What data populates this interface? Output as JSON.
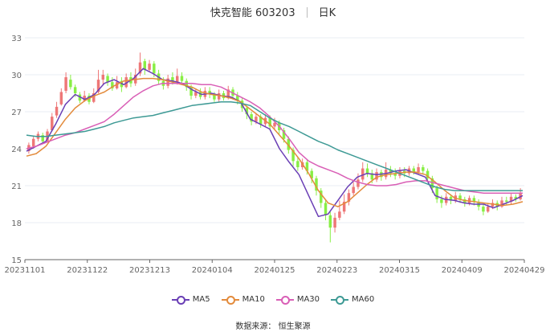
{
  "title": {
    "name": "快克智能 603203",
    "period": "日K"
  },
  "source": "数据来源： 恒生聚源",
  "colors": {
    "up": "#ee7777",
    "down": "#88ee44",
    "grid": "#e9ecf3",
    "axis": "#666666"
  },
  "chart_data": {
    "type": "candlestick",
    "ylim": [
      15,
      33
    ],
    "yticks": [
      15,
      18,
      21,
      24,
      27,
      30,
      33
    ],
    "xticks": [
      "20231101",
      "20231122",
      "20231213",
      "20240104",
      "20240125",
      "20240223",
      "20240315",
      "20240409",
      "20240429"
    ],
    "candles_approx": [
      [
        23.8,
        24.3,
        23.6,
        24.5
      ],
      [
        24.2,
        24.8,
        24.0,
        25.0
      ],
      [
        24.8,
        25.2,
        24.6,
        25.4
      ],
      [
        25.1,
        24.6,
        24.4,
        25.3
      ],
      [
        24.6,
        25.4,
        24.5,
        25.6
      ],
      [
        25.5,
        26.6,
        25.4,
        26.9
      ],
      [
        26.7,
        27.4,
        26.5,
        27.8
      ],
      [
        27.6,
        28.6,
        27.5,
        28.9
      ],
      [
        28.7,
        29.8,
        28.5,
        30.2
      ],
      [
        29.6,
        29.0,
        28.8,
        30.0
      ],
      [
        29.0,
        28.5,
        28.2,
        29.2
      ],
      [
        28.4,
        27.9,
        27.7,
        28.6
      ],
      [
        27.9,
        28.3,
        27.8,
        28.7
      ],
      [
        28.3,
        27.8,
        27.6,
        28.5
      ],
      [
        27.8,
        28.5,
        27.7,
        28.9
      ],
      [
        28.6,
        29.6,
        28.5,
        30.4
      ],
      [
        29.6,
        30.0,
        29.2,
        30.4
      ],
      [
        29.9,
        29.4,
        29.1,
        30.1
      ],
      [
        29.4,
        28.9,
        28.7,
        29.8
      ],
      [
        28.9,
        29.4,
        28.8,
        29.9
      ],
      [
        29.5,
        29.0,
        28.6,
        29.8
      ],
      [
        29.0,
        29.8,
        28.9,
        30.1
      ],
      [
        29.8,
        29.3,
        29.0,
        30.2
      ],
      [
        29.3,
        30.0,
        29.1,
        30.5
      ],
      [
        30.1,
        31.0,
        29.9,
        31.8
      ],
      [
        31.1,
        30.4,
        30.0,
        31.3
      ],
      [
        30.4,
        30.9,
        30.2,
        31.2
      ],
      [
        30.9,
        30.1,
        29.8,
        31.1
      ],
      [
        30.1,
        29.5,
        29.2,
        30.4
      ],
      [
        29.5,
        29.1,
        28.8,
        29.8
      ],
      [
        29.1,
        29.7,
        28.9,
        30.0
      ],
      [
        29.8,
        29.4,
        29.2,
        30.2
      ],
      [
        29.4,
        29.9,
        29.2,
        30.5
      ],
      [
        29.9,
        29.5,
        29.3,
        30.2
      ],
      [
        29.5,
        29.0,
        28.7,
        29.7
      ],
      [
        29.0,
        28.3,
        28.0,
        29.2
      ],
      [
        28.3,
        28.6,
        28.1,
        28.9
      ],
      [
        28.6,
        28.2,
        28.0,
        28.9
      ],
      [
        28.2,
        28.7,
        28.0,
        29.0
      ],
      [
        28.7,
        28.4,
        28.1,
        29.0
      ],
      [
        28.4,
        28.0,
        27.8,
        28.6
      ],
      [
        28.0,
        28.5,
        27.8,
        28.8
      ],
      [
        28.5,
        28.1,
        27.9,
        28.7
      ],
      [
        28.1,
        28.8,
        28.0,
        29.1
      ],
      [
        28.8,
        28.3,
        28.0,
        29.0
      ],
      [
        28.3,
        27.9,
        27.6,
        28.6
      ],
      [
        27.9,
        27.3,
        27.0,
        28.1
      ],
      [
        27.3,
        26.8,
        26.4,
        27.5
      ],
      [
        26.8,
        26.2,
        25.9,
        27.0
      ],
      [
        26.2,
        26.6,
        26.0,
        26.9
      ],
      [
        26.6,
        26.0,
        25.7,
        26.8
      ],
      [
        26.0,
        26.5,
        25.8,
        26.8
      ],
      [
        26.5,
        25.8,
        25.5,
        26.7
      ],
      [
        25.8,
        26.1,
        25.6,
        26.5
      ],
      [
        26.1,
        25.5,
        25.2,
        26.3
      ],
      [
        25.5,
        24.8,
        24.5,
        25.7
      ],
      [
        24.8,
        23.9,
        23.6,
        25.0
      ],
      [
        23.9,
        23.0,
        22.6,
        24.1
      ],
      [
        23.0,
        22.5,
        22.2,
        23.3
      ],
      [
        22.5,
        22.9,
        22.3,
        23.2
      ],
      [
        22.9,
        22.2,
        21.9,
        23.1
      ],
      [
        22.2,
        21.6,
        21.2,
        22.4
      ],
      [
        21.6,
        20.6,
        20.2,
        21.8
      ],
      [
        20.6,
        19.6,
        19.2,
        20.8
      ],
      [
        19.6,
        18.6,
        18.2,
        19.9
      ],
      [
        18.6,
        17.6,
        16.4,
        18.9
      ],
      [
        17.6,
        18.4,
        17.2,
        18.8
      ],
      [
        18.4,
        18.9,
        18.2,
        19.8
      ],
      [
        18.9,
        19.7,
        18.7,
        20.3
      ],
      [
        19.7,
        20.4,
        19.4,
        20.7
      ],
      [
        20.4,
        20.9,
        20.2,
        21.3
      ],
      [
        20.9,
        21.5,
        20.7,
        22.0
      ],
      [
        21.5,
        22.4,
        21.3,
        22.9
      ],
      [
        22.4,
        22.0,
        21.7,
        22.8
      ],
      [
        22.0,
        21.5,
        21.2,
        22.3
      ],
      [
        21.5,
        22.1,
        21.3,
        22.4
      ],
      [
        22.1,
        21.7,
        21.4,
        22.3
      ],
      [
        21.7,
        22.3,
        21.5,
        22.9
      ],
      [
        22.3,
        22.0,
        21.7,
        22.6
      ],
      [
        22.0,
        21.8,
        21.5,
        22.4
      ],
      [
        21.8,
        22.2,
        21.6,
        22.5
      ],
      [
        22.2,
        22.0,
        21.7,
        22.5
      ],
      [
        22.0,
        22.4,
        21.8,
        22.6
      ],
      [
        22.4,
        22.1,
        21.9,
        22.6
      ],
      [
        22.1,
        22.5,
        21.9,
        22.8
      ],
      [
        22.5,
        22.2,
        21.9,
        22.7
      ],
      [
        22.2,
        21.6,
        21.3,
        22.4
      ],
      [
        21.6,
        20.8,
        20.4,
        21.8
      ],
      [
        20.8,
        19.9,
        19.6,
        21.0
      ],
      [
        19.9,
        19.6,
        19.2,
        20.2
      ],
      [
        19.6,
        20.1,
        19.4,
        20.4
      ],
      [
        20.1,
        19.8,
        19.5,
        20.3
      ],
      [
        19.8,
        20.2,
        19.6,
        20.5
      ],
      [
        20.2,
        19.9,
        19.6,
        20.4
      ],
      [
        19.9,
        19.6,
        19.3,
        20.1
      ],
      [
        19.6,
        20.0,
        19.4,
        20.2
      ],
      [
        20.0,
        19.7,
        19.4,
        20.2
      ],
      [
        19.7,
        19.3,
        19.0,
        19.9
      ],
      [
        19.3,
        18.9,
        18.6,
        19.5
      ],
      [
        18.9,
        19.3,
        18.8,
        19.6
      ],
      [
        19.3,
        19.6,
        19.1,
        19.9
      ],
      [
        19.6,
        19.3,
        19.0,
        19.8
      ],
      [
        19.3,
        19.8,
        19.2,
        20.1
      ],
      [
        19.8,
        19.7,
        19.4,
        20.1
      ],
      [
        19.7,
        20.1,
        19.5,
        20.4
      ],
      [
        20.1,
        19.9,
        19.7,
        20.3
      ],
      [
        19.9,
        20.4,
        19.8,
        20.8
      ]
    ],
    "series": [
      {
        "name": "MA5",
        "color": "#6a3fb5",
        "y": [
          23.8,
          24.2,
          24.6,
          26.0,
          27.6,
          28.4,
          28.0,
          28.4,
          29.3,
          29.6,
          29.2,
          29.7,
          30.5,
          30.1,
          29.6,
          29.5,
          29.3,
          28.8,
          28.4,
          28.5,
          28.3,
          28.2,
          27.8,
          26.4,
          26.0,
          25.6,
          24.0,
          22.9,
          21.9,
          20.2,
          18.5,
          18.7,
          19.8,
          20.9,
          21.7,
          22.0,
          21.9,
          22.0,
          22.2,
          22.3,
          22.0,
          21.7,
          20.2,
          19.9,
          19.8,
          19.6,
          19.5,
          19.5,
          19.2,
          19.5,
          19.8,
          20.2
        ]
      },
      {
        "name": "MA10",
        "color": "#e38b3c",
        "y": [
          23.4,
          23.6,
          24.2,
          25.3,
          26.4,
          27.3,
          27.9,
          28.3,
          28.6,
          29.1,
          29.5,
          29.6,
          29.7,
          29.7,
          29.6,
          29.4,
          29.2,
          29.0,
          28.6,
          28.4,
          28.3,
          28.1,
          27.8,
          27.2,
          26.6,
          26.0,
          25.1,
          24.2,
          23.2,
          22.0,
          20.6,
          19.6,
          19.3,
          19.7,
          20.4,
          21.1,
          21.7,
          21.9,
          22.0,
          22.1,
          22.1,
          21.9,
          21.3,
          20.6,
          20.0,
          19.8,
          19.7,
          19.6,
          19.5,
          19.4,
          19.5,
          19.7
        ]
      },
      {
        "name": "MA30",
        "color": "#d95fb6",
        "y": [
          24.0,
          24.2,
          24.5,
          24.8,
          25.1,
          25.3,
          25.6,
          25.9,
          26.2,
          26.8,
          27.5,
          28.2,
          28.7,
          29.1,
          29.3,
          29.3,
          29.3,
          29.3,
          29.2,
          29.2,
          29.0,
          28.6,
          28.2,
          27.8,
          27.3,
          26.6,
          25.8,
          24.8,
          23.7,
          23.0,
          22.6,
          22.3,
          22.0,
          21.6,
          21.3,
          21.1,
          21.0,
          21.0,
          21.1,
          21.3,
          21.4,
          21.4,
          21.2,
          21.0,
          20.8,
          20.6,
          20.5,
          20.4,
          20.4,
          20.4,
          20.4,
          20.4
        ]
      },
      {
        "name": "MA60",
        "color": "#3e9a95",
        "y": [
          25.1,
          25.0,
          25.0,
          25.1,
          25.2,
          25.3,
          25.4,
          25.6,
          25.8,
          26.1,
          26.3,
          26.5,
          26.6,
          26.7,
          26.9,
          27.1,
          27.3,
          27.5,
          27.6,
          27.7,
          27.8,
          27.8,
          27.7,
          27.5,
          27.0,
          26.5,
          26.1,
          25.8,
          25.4,
          25.0,
          24.6,
          24.3,
          23.9,
          23.6,
          23.3,
          23.0,
          22.7,
          22.4,
          22.1,
          21.8,
          21.5,
          21.2,
          20.9,
          20.7,
          20.6,
          20.6,
          20.6,
          20.6,
          20.6,
          20.6,
          20.6,
          20.6
        ]
      }
    ]
  }
}
